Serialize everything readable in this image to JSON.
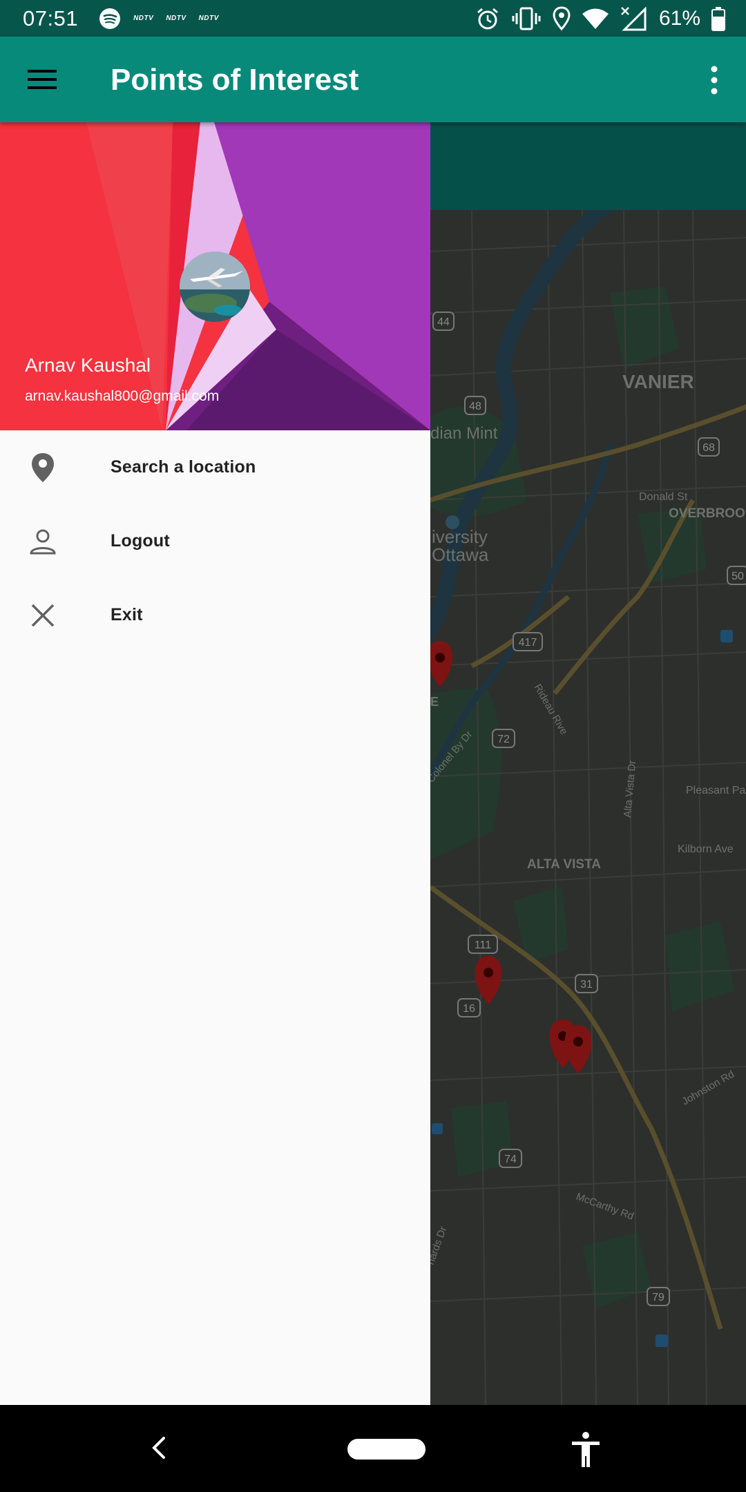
{
  "status_bar": {
    "time": "07:51",
    "left_icons": [
      "spotify-icon",
      "ndtv-icon",
      "ndtv-icon",
      "ndtv-icon"
    ],
    "ndtv_label": "NDTV",
    "right_icons": [
      "alarm-icon",
      "vibrate-icon",
      "location-icon",
      "wifi-icon",
      "signal-icon",
      "battery-icon"
    ],
    "battery": "61%"
  },
  "app_bar": {
    "title": "Points of Interest",
    "menu_icon": "hamburger-menu-icon",
    "overflow_icon": "more-vert-icon",
    "color": "#088a7a"
  },
  "drawer": {
    "user": {
      "name": "Arnav Kaushal",
      "email": "arnav.kaushal800@gmail.com"
    },
    "items": [
      {
        "label": "Search a location",
        "icon": "location-pin-icon"
      },
      {
        "label": "Logout",
        "icon": "person-icon"
      },
      {
        "label": "Exit",
        "icon": "close-icon"
      }
    ]
  },
  "map": {
    "labels": [
      {
        "text": "VANIER"
      },
      {
        "text": "dian Mint"
      },
      {
        "text": "iversity"
      },
      {
        "text": "Ottawa"
      },
      {
        "text": "Donald St"
      },
      {
        "text": "OVERBROO"
      },
      {
        "text": "Rideau Rive"
      },
      {
        "text": "Colonel By Dr"
      },
      {
        "text": "Alta Vista Dr"
      },
      {
        "text": "Pleasant Pa"
      },
      {
        "text": "Kilborn Ave"
      },
      {
        "text": "ALTA VISTA"
      },
      {
        "text": "Johnston Rd"
      },
      {
        "text": "McCarthy Rd"
      },
      {
        "text": "hards Dr"
      },
      {
        "text": "E"
      }
    ],
    "route_shields": [
      "44",
      "48",
      "68",
      "50",
      "417",
      "72",
      "111",
      "31",
      "16",
      "74",
      "79"
    ],
    "marker_icon": "map-marker-icon",
    "marker_count": 4
  },
  "nav_bar": {
    "icons": [
      "back-icon",
      "home-pill-icon",
      "accessibility-icon"
    ]
  }
}
